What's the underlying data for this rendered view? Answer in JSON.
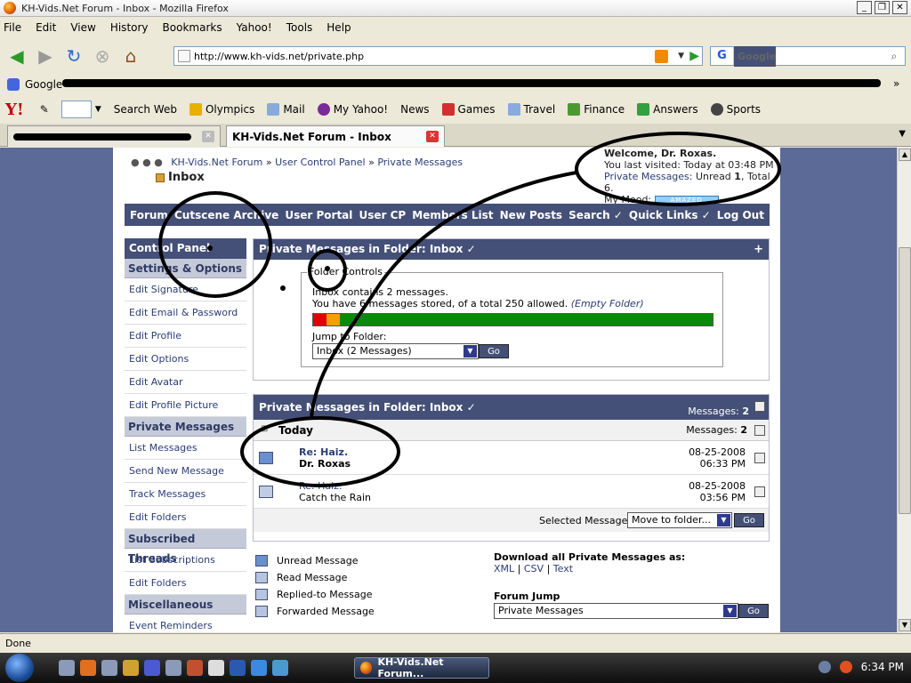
{
  "window": {
    "title": "KH-Vids.Net Forum - Inbox - Mozilla Firefox"
  },
  "menu": [
    "File",
    "Edit",
    "View",
    "History",
    "Bookmarks",
    "Yahoo!",
    "Tools",
    "Help"
  ],
  "address": {
    "url": "http://www.kh-vids.net/private.php"
  },
  "search": {
    "placeholder": "Google",
    "engine_letter": "G"
  },
  "bookmarks": {
    "first": "Google"
  },
  "yahoo_toolbar": {
    "logo": "Y!",
    "items": [
      "Search Web",
      "Olympics",
      "Mail",
      "My Yahoo!",
      "News",
      "Games",
      "Travel",
      "Finance",
      "Answers",
      "Sports"
    ]
  },
  "tabs": [
    {
      "label": "KH-Vids.Net Forum - Inbox",
      "active": true
    }
  ],
  "breadcrumb": {
    "site": "KH-Vids.Net Forum",
    "sep": "»",
    "ucp": "User Control Panel",
    "pm": "Private Messages",
    "current": "Inbox"
  },
  "welcome": {
    "title": "Welcome, Dr. Roxas.",
    "last_visited": "You last visited: Today at 03:48 PM",
    "pm_prefix": "Private Messages:",
    "pm_unread_label": "Unread",
    "pm_unread": "1",
    "pm_total_label": "Total",
    "pm_total": "6.",
    "mood_label": "My Mood:",
    "mood": "AMAZED"
  },
  "nav": [
    "Forum",
    "Cutscene Archive",
    "User Portal",
    "User CP",
    "Members List",
    "New Posts",
    "Search ✓",
    "Quick Links ✓",
    "Log Out"
  ],
  "sidebar": {
    "header": "Control Panel",
    "sections": [
      {
        "title": "Settings & Options",
        "items": [
          "Edit Signature",
          "Edit Email & Password",
          "Edit Profile",
          "Edit Options",
          "Edit Avatar",
          "Edit Profile Picture"
        ]
      },
      {
        "title": "Private Messages",
        "items": [
          "List Messages",
          "Send New Message",
          "Track Messages",
          "Edit Folders"
        ]
      },
      {
        "title": "Subscribed Threads",
        "items": [
          "List Subscriptions",
          "Edit Folders"
        ]
      },
      {
        "title": "Miscellaneous",
        "items": [
          "Event Reminders"
        ]
      }
    ]
  },
  "folder_panel": {
    "header": "Private Messages in Folder: Inbox ✓",
    "plus": "+",
    "legend": "Folder Controls",
    "line1": "Inbox contains 2 messages.",
    "line2_prefix": "You have 6 messages stored, of a total 250 allowed.",
    "line2_link": "(Empty Folder)",
    "usage_fraction": 0.024,
    "jump_label": "Jump to Folder:",
    "jump_value": "Inbox (2 Messages)",
    "go": "Go"
  },
  "messages_panel": {
    "header": "Private Messages in Folder: Inbox ✓",
    "count_label": "Messages:",
    "count": "2",
    "group": "Today",
    "rows": [
      {
        "title": "Re: Haiz.",
        "from": "Dr. Roxas",
        "date": "08-25-2008",
        "time": "06:33 PM",
        "unread": true
      },
      {
        "title": "Re: Haiz.",
        "from": "Catch the Rain",
        "date": "08-25-2008",
        "time": "03:56 PM",
        "unread": false
      }
    ],
    "selected_label": "Selected Messages:",
    "selected_action": "Move to folder...",
    "go": "Go"
  },
  "legend": [
    "Unread Message",
    "Read Message",
    "Replied-to Message",
    "Forwarded Message"
  ],
  "download": {
    "title": "Download all Private Messages as:",
    "formats": [
      "XML",
      "CSV",
      "Text"
    ],
    "sep": "|"
  },
  "forum_jump": {
    "label": "Forum Jump",
    "value": "Private Messages",
    "go": "Go"
  },
  "status": {
    "text": "Done"
  },
  "taskbar": {
    "task": "KH-Vids.Net Forum...",
    "clock": "6:34 PM"
  }
}
